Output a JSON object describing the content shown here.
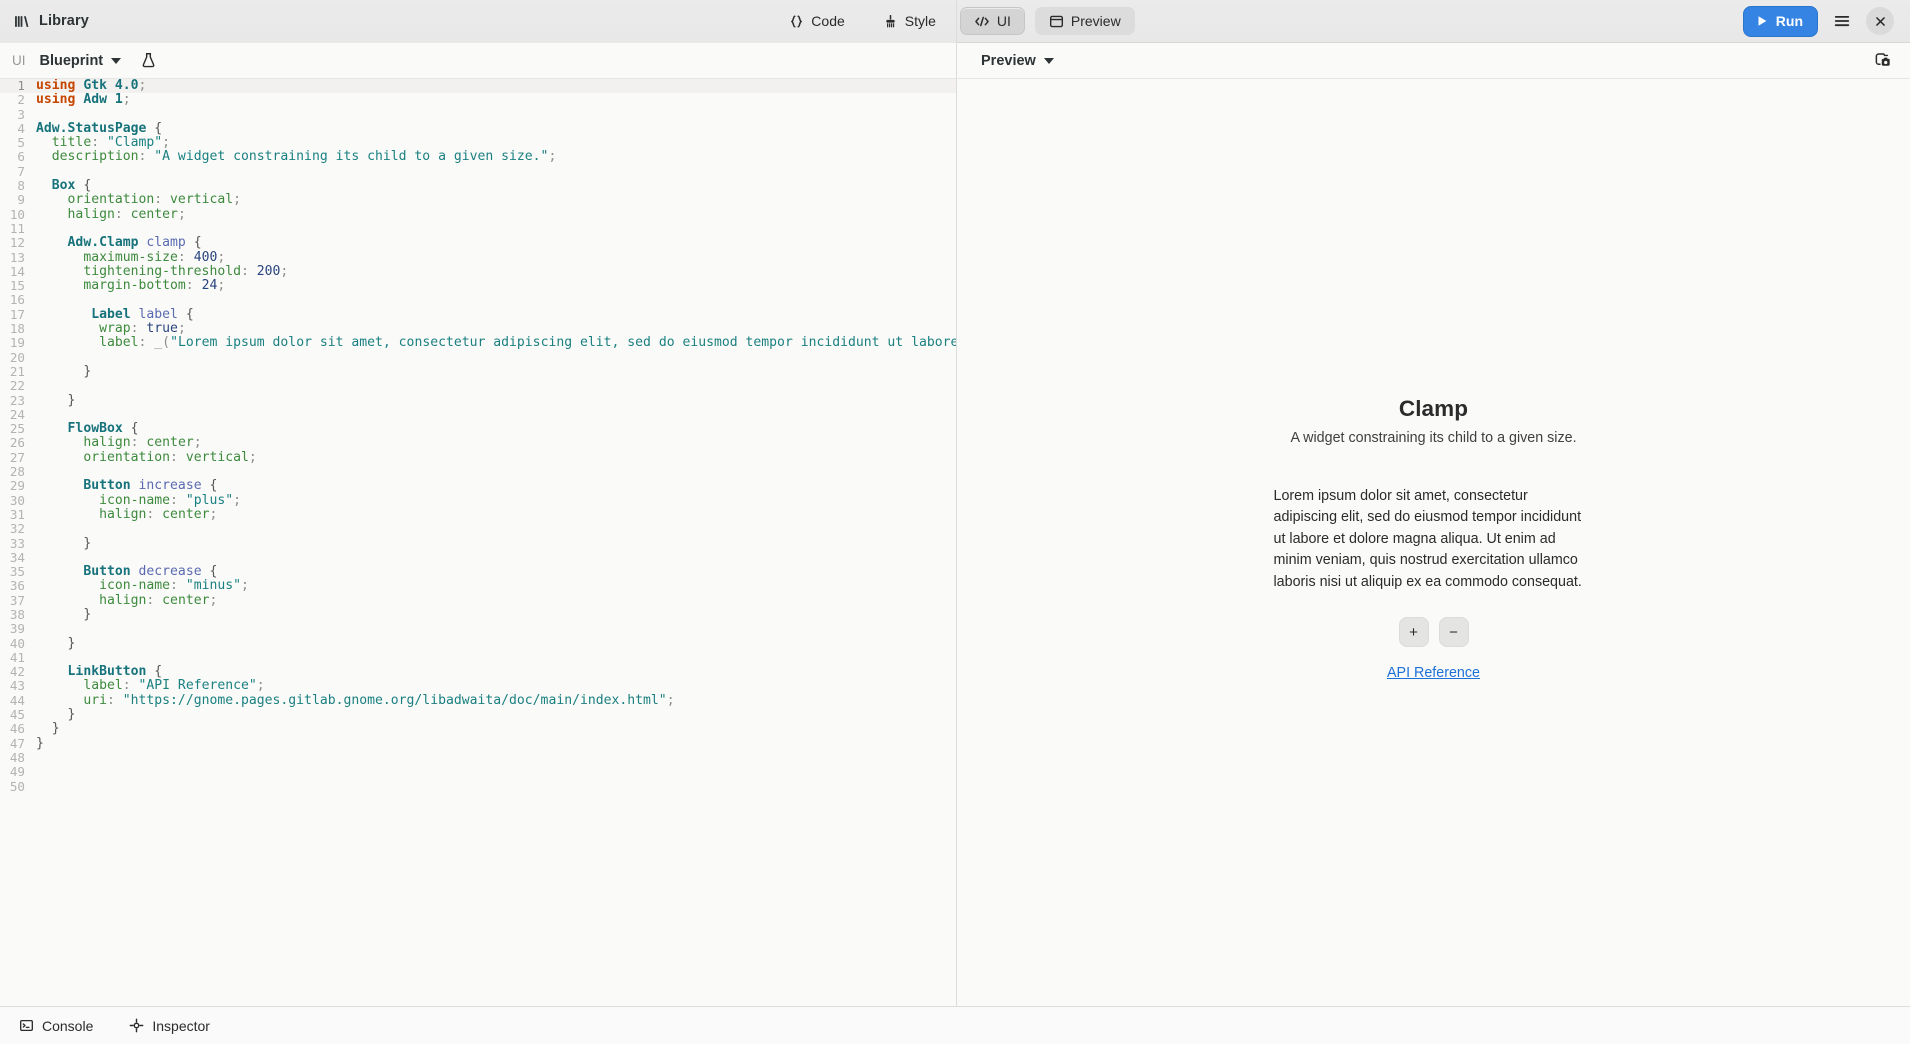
{
  "window": {
    "title": "Library",
    "title_icon": "books-icon"
  },
  "header": {
    "tabs": [
      {
        "label": "Code",
        "icon": "braces-icon",
        "selected": false,
        "pill": false
      },
      {
        "label": "Style",
        "icon": "brush-icon",
        "selected": false,
        "pill": false
      },
      {
        "label": "UI",
        "icon": "code-slash-icon",
        "selected": true,
        "pill": true
      },
      {
        "label": "Preview",
        "icon": "window-icon",
        "selected": false,
        "pill": true
      }
    ],
    "run_label": "Run",
    "run_icon": "play-icon",
    "run_color": "#3584e4",
    "menu_icon": "hamburger-menu-icon",
    "close_icon": "close-icon"
  },
  "code_panel": {
    "lang_tag": "UI",
    "language": "Blueprint",
    "caret_icon": "chevron-down-icon",
    "flask_icon": "flask-icon",
    "current_line": 1,
    "total_lines": 50,
    "lines": [
      {
        "n": 1,
        "tokens": [
          {
            "t": "k",
            "v": "using"
          },
          {
            "t": "w",
            "v": " "
          },
          {
            "t": "ty",
            "v": "Gtk 4.0"
          },
          {
            "t": "pn",
            "v": ";"
          }
        ]
      },
      {
        "n": 2,
        "tokens": [
          {
            "t": "k",
            "v": "using"
          },
          {
            "t": "w",
            "v": " "
          },
          {
            "t": "ty",
            "v": "Adw 1"
          },
          {
            "t": "pn",
            "v": ";"
          }
        ]
      },
      {
        "n": 3,
        "tokens": []
      },
      {
        "n": 4,
        "tokens": [
          {
            "t": "ty",
            "v": "Adw.StatusPage"
          },
          {
            "t": "w",
            "v": " "
          },
          {
            "t": "br",
            "v": "{"
          }
        ]
      },
      {
        "n": 5,
        "tokens": [
          {
            "t": "w",
            "v": "  "
          },
          {
            "t": "pr",
            "v": "title"
          },
          {
            "t": "pn",
            "v": ":"
          },
          {
            "t": "w",
            "v": " "
          },
          {
            "t": "st",
            "v": "\"Clamp\""
          },
          {
            "t": "pn",
            "v": ";"
          }
        ]
      },
      {
        "n": 6,
        "tokens": [
          {
            "t": "w",
            "v": "  "
          },
          {
            "t": "pr",
            "v": "description"
          },
          {
            "t": "pn",
            "v": ":"
          },
          {
            "t": "w",
            "v": " "
          },
          {
            "t": "st",
            "v": "\"A widget constraining its child to a given size.\""
          },
          {
            "t": "pn",
            "v": ";"
          }
        ]
      },
      {
        "n": 7,
        "tokens": []
      },
      {
        "n": 8,
        "tokens": [
          {
            "t": "w",
            "v": "  "
          },
          {
            "t": "ty",
            "v": "Box"
          },
          {
            "t": "w",
            "v": " "
          },
          {
            "t": "br",
            "v": "{"
          }
        ]
      },
      {
        "n": 9,
        "tokens": [
          {
            "t": "w",
            "v": "    "
          },
          {
            "t": "pr",
            "v": "orientation"
          },
          {
            "t": "pn",
            "v": ":"
          },
          {
            "t": "w",
            "v": " "
          },
          {
            "t": "pr",
            "v": "vertical"
          },
          {
            "t": "pn",
            "v": ";"
          }
        ]
      },
      {
        "n": 10,
        "tokens": [
          {
            "t": "w",
            "v": "    "
          },
          {
            "t": "pr",
            "v": "halign"
          },
          {
            "t": "pn",
            "v": ":"
          },
          {
            "t": "w",
            "v": " "
          },
          {
            "t": "pr",
            "v": "center"
          },
          {
            "t": "pn",
            "v": ";"
          }
        ]
      },
      {
        "n": 11,
        "tokens": []
      },
      {
        "n": 12,
        "tokens": [
          {
            "t": "w",
            "v": "    "
          },
          {
            "t": "ty",
            "v": "Adw.Clamp"
          },
          {
            "t": "w",
            "v": " "
          },
          {
            "t": "id",
            "v": "clamp"
          },
          {
            "t": "w",
            "v": " "
          },
          {
            "t": "br",
            "v": "{"
          }
        ]
      },
      {
        "n": 13,
        "tokens": [
          {
            "t": "w",
            "v": "      "
          },
          {
            "t": "pr",
            "v": "maximum-size"
          },
          {
            "t": "pn",
            "v": ":"
          },
          {
            "t": "w",
            "v": " "
          },
          {
            "t": "nu",
            "v": "400"
          },
          {
            "t": "pn",
            "v": ";"
          }
        ]
      },
      {
        "n": 14,
        "tokens": [
          {
            "t": "w",
            "v": "      "
          },
          {
            "t": "pr",
            "v": "tightening-threshold"
          },
          {
            "t": "pn",
            "v": ":"
          },
          {
            "t": "w",
            "v": " "
          },
          {
            "t": "nu",
            "v": "200"
          },
          {
            "t": "pn",
            "v": ";"
          }
        ]
      },
      {
        "n": 15,
        "tokens": [
          {
            "t": "w",
            "v": "      "
          },
          {
            "t": "pr",
            "v": "margin-bottom"
          },
          {
            "t": "pn",
            "v": ":"
          },
          {
            "t": "w",
            "v": " "
          },
          {
            "t": "nu",
            "v": "24"
          },
          {
            "t": "pn",
            "v": ";"
          }
        ]
      },
      {
        "n": 16,
        "tokens": []
      },
      {
        "n": 17,
        "tokens": [
          {
            "t": "w",
            "v": "       "
          },
          {
            "t": "ty",
            "v": "Label"
          },
          {
            "t": "w",
            "v": " "
          },
          {
            "t": "id",
            "v": "label"
          },
          {
            "t": "w",
            "v": " "
          },
          {
            "t": "br",
            "v": "{"
          }
        ]
      },
      {
        "n": 18,
        "tokens": [
          {
            "t": "w",
            "v": "        "
          },
          {
            "t": "pr",
            "v": "wrap"
          },
          {
            "t": "pn",
            "v": ":"
          },
          {
            "t": "w",
            "v": " "
          },
          {
            "t": "nu",
            "v": "true"
          },
          {
            "t": "pn",
            "v": ";"
          }
        ]
      },
      {
        "n": 19,
        "tokens": [
          {
            "t": "w",
            "v": "        "
          },
          {
            "t": "pr",
            "v": "label"
          },
          {
            "t": "pn",
            "v": ":"
          },
          {
            "t": "w",
            "v": " "
          },
          {
            "t": "fn",
            "v": "_("
          },
          {
            "t": "st",
            "v": "\"Lorem ipsum dolor sit amet, consectetur adipiscing elit, sed do eiusmod tempor incididunt ut labore et dolore magna aliqua. Ut enim ad minim veniam, quis nostrud exercitation ullamco laboris nisi ut aliquip ex ea commodo consequat.\""
          },
          {
            "t": "fn",
            "v": ")"
          },
          {
            "t": "pn",
            "v": ";"
          }
        ]
      },
      {
        "n": 20,
        "tokens": []
      },
      {
        "n": 21,
        "tokens": [
          {
            "t": "w",
            "v": "      "
          },
          {
            "t": "br",
            "v": "}"
          }
        ]
      },
      {
        "n": 22,
        "tokens": []
      },
      {
        "n": 23,
        "tokens": [
          {
            "t": "w",
            "v": "    "
          },
          {
            "t": "br",
            "v": "}"
          }
        ]
      },
      {
        "n": 24,
        "tokens": []
      },
      {
        "n": 25,
        "tokens": [
          {
            "t": "w",
            "v": "    "
          },
          {
            "t": "ty",
            "v": "FlowBox"
          },
          {
            "t": "w",
            "v": " "
          },
          {
            "t": "br",
            "v": "{"
          }
        ]
      },
      {
        "n": 26,
        "tokens": [
          {
            "t": "w",
            "v": "      "
          },
          {
            "t": "pr",
            "v": "halign"
          },
          {
            "t": "pn",
            "v": ":"
          },
          {
            "t": "w",
            "v": " "
          },
          {
            "t": "pr",
            "v": "center"
          },
          {
            "t": "pn",
            "v": ";"
          }
        ]
      },
      {
        "n": 27,
        "tokens": [
          {
            "t": "w",
            "v": "      "
          },
          {
            "t": "pr",
            "v": "orientation"
          },
          {
            "t": "pn",
            "v": ":"
          },
          {
            "t": "w",
            "v": " "
          },
          {
            "t": "pr",
            "v": "vertical"
          },
          {
            "t": "pn",
            "v": ";"
          }
        ]
      },
      {
        "n": 28,
        "tokens": []
      },
      {
        "n": 29,
        "tokens": [
          {
            "t": "w",
            "v": "      "
          },
          {
            "t": "ty",
            "v": "Button"
          },
          {
            "t": "w",
            "v": " "
          },
          {
            "t": "id",
            "v": "increase"
          },
          {
            "t": "w",
            "v": " "
          },
          {
            "t": "br",
            "v": "{"
          }
        ]
      },
      {
        "n": 30,
        "tokens": [
          {
            "t": "w",
            "v": "        "
          },
          {
            "t": "pr",
            "v": "icon-name"
          },
          {
            "t": "pn",
            "v": ":"
          },
          {
            "t": "w",
            "v": " "
          },
          {
            "t": "st",
            "v": "\"plus\""
          },
          {
            "t": "pn",
            "v": ";"
          }
        ]
      },
      {
        "n": 31,
        "tokens": [
          {
            "t": "w",
            "v": "        "
          },
          {
            "t": "pr",
            "v": "halign"
          },
          {
            "t": "pn",
            "v": ":"
          },
          {
            "t": "w",
            "v": " "
          },
          {
            "t": "pr",
            "v": "center"
          },
          {
            "t": "pn",
            "v": ";"
          }
        ]
      },
      {
        "n": 32,
        "tokens": []
      },
      {
        "n": 33,
        "tokens": [
          {
            "t": "w",
            "v": "      "
          },
          {
            "t": "br",
            "v": "}"
          }
        ]
      },
      {
        "n": 34,
        "tokens": []
      },
      {
        "n": 35,
        "tokens": [
          {
            "t": "w",
            "v": "      "
          },
          {
            "t": "ty",
            "v": "Button"
          },
          {
            "t": "w",
            "v": " "
          },
          {
            "t": "id",
            "v": "decrease"
          },
          {
            "t": "w",
            "v": " "
          },
          {
            "t": "br",
            "v": "{"
          }
        ]
      },
      {
        "n": 36,
        "tokens": [
          {
            "t": "w",
            "v": "        "
          },
          {
            "t": "pr",
            "v": "icon-name"
          },
          {
            "t": "pn",
            "v": ":"
          },
          {
            "t": "w",
            "v": " "
          },
          {
            "t": "st",
            "v": "\"minus\""
          },
          {
            "t": "pn",
            "v": ";"
          }
        ]
      },
      {
        "n": 37,
        "tokens": [
          {
            "t": "w",
            "v": "        "
          },
          {
            "t": "pr",
            "v": "halign"
          },
          {
            "t": "pn",
            "v": ":"
          },
          {
            "t": "w",
            "v": " "
          },
          {
            "t": "pr",
            "v": "center"
          },
          {
            "t": "pn",
            "v": ";"
          }
        ]
      },
      {
        "n": 38,
        "tokens": [
          {
            "t": "w",
            "v": "      "
          },
          {
            "t": "br",
            "v": "}"
          }
        ]
      },
      {
        "n": 39,
        "tokens": []
      },
      {
        "n": 40,
        "tokens": [
          {
            "t": "w",
            "v": "    "
          },
          {
            "t": "br",
            "v": "}"
          }
        ]
      },
      {
        "n": 41,
        "tokens": []
      },
      {
        "n": 42,
        "tokens": [
          {
            "t": "w",
            "v": "    "
          },
          {
            "t": "ty",
            "v": "LinkButton"
          },
          {
            "t": "w",
            "v": " "
          },
          {
            "t": "br",
            "v": "{"
          }
        ]
      },
      {
        "n": 43,
        "tokens": [
          {
            "t": "w",
            "v": "      "
          },
          {
            "t": "pr",
            "v": "label"
          },
          {
            "t": "pn",
            "v": ":"
          },
          {
            "t": "w",
            "v": " "
          },
          {
            "t": "st",
            "v": "\"API Reference\""
          },
          {
            "t": "pn",
            "v": ";"
          }
        ]
      },
      {
        "n": 44,
        "tokens": [
          {
            "t": "w",
            "v": "      "
          },
          {
            "t": "pr",
            "v": "uri"
          },
          {
            "t": "pn",
            "v": ":"
          },
          {
            "t": "w",
            "v": " "
          },
          {
            "t": "st",
            "v": "\"https://gnome.pages.gitlab.gnome.org/libadwaita/doc/main/index.html\""
          },
          {
            "t": "pn",
            "v": ";"
          }
        ]
      },
      {
        "n": 45,
        "tokens": [
          {
            "t": "w",
            "v": "    "
          },
          {
            "t": "br",
            "v": "}"
          }
        ]
      },
      {
        "n": 46,
        "tokens": [
          {
            "t": "w",
            "v": "  "
          },
          {
            "t": "br",
            "v": "}"
          }
        ]
      },
      {
        "n": 47,
        "tokens": [
          {
            "t": "br",
            "v": "}"
          }
        ]
      },
      {
        "n": 48,
        "tokens": []
      },
      {
        "n": 49,
        "tokens": []
      },
      {
        "n": 50,
        "tokens": []
      }
    ]
  },
  "preview_panel": {
    "header_label": "Preview",
    "caret_icon": "chevron-down-icon",
    "camera_icon": "screenshot-camera-icon",
    "status_page": {
      "title": "Clamp",
      "description": "A widget constraining its child to a given size.",
      "body": "Lorem ipsum dolor sit amet, consectetur adipiscing elit, sed do eiusmod tempor incididunt ut labore et dolore magna aliqua. Ut enim ad minim veniam, quis nostrud exercitation ullamco laboris nisi ut aliquip ex ea commodo consequat.",
      "increase_button": "+",
      "decrease_button": "−",
      "link_label": "API Reference",
      "link_color": "#1c71d8"
    }
  },
  "bottom_bar": {
    "items": [
      {
        "label": "Console",
        "icon": "terminal-icon"
      },
      {
        "label": "Inspector",
        "icon": "crosshair-icon"
      }
    ]
  }
}
